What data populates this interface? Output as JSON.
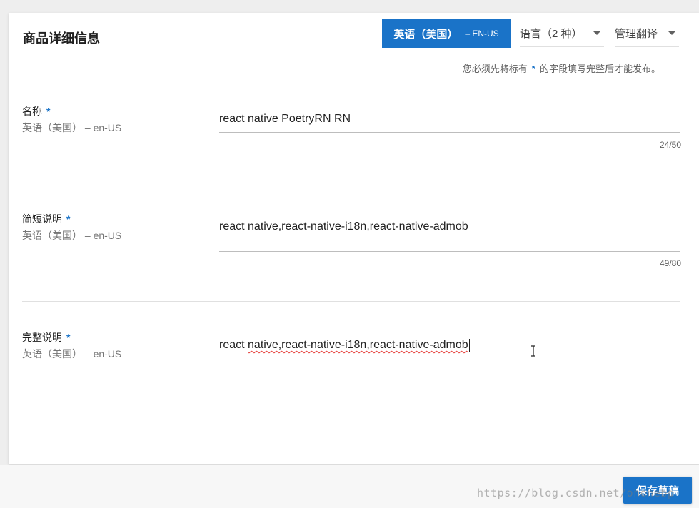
{
  "section_title": "商品详细信息",
  "language_tab": {
    "label": "英语（美国）",
    "code": "– EN-US"
  },
  "language_dropdown": {
    "label": "语言（2 种）"
  },
  "manage_translation_dropdown": {
    "label": "管理翻译"
  },
  "notice": {
    "before": "您必须先将标有",
    "star": "*",
    "after": "的字段填写完整后才能发布。"
  },
  "fields": [
    {
      "label": "名称",
      "star": "*",
      "language": "英语（美国） – en-US",
      "value": "react native PoetryRN RN",
      "counter": "24/50"
    },
    {
      "label": "简短说明",
      "star": "*",
      "language": "英语（美国） – en-US",
      "value": "react native,react-native-i18n,react-native-admob",
      "counter": "49/80"
    },
    {
      "label": "完整说明",
      "star": "*",
      "language": "英语（美国） – en-US",
      "value_prefix": "react ",
      "value_spellcheck": "native,react-native-i18n,react-native-admob"
    }
  ],
  "save_button": {
    "label": "保存草稿"
  },
  "watermark": "https://blog.csdn.net/ohonebp",
  "colors": {
    "accent": "#1a73c8",
    "spellcheck": "#e53935"
  }
}
